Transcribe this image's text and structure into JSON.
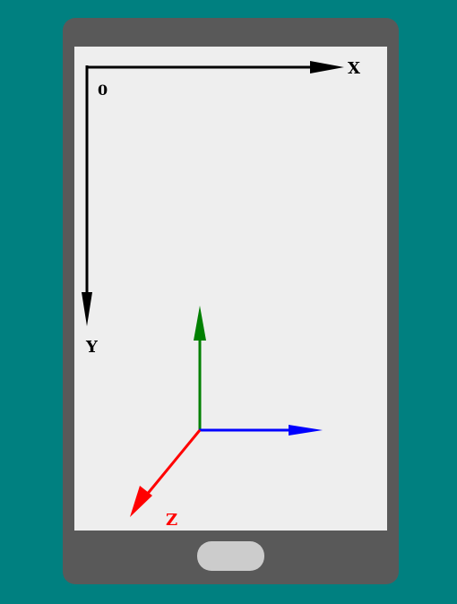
{
  "screen_axes": {
    "origin_label": "0",
    "x_label": "X",
    "y_label": "Y"
  },
  "device_axes": {
    "z_label": "Z"
  },
  "colors": {
    "background": "#008080",
    "phone_body": "#595959",
    "screen": "#eeeeee",
    "home_button": "#cccccc",
    "screen_axes": "#000000",
    "axis_vertical": "#008000",
    "axis_horizontal": "#0000ff",
    "axis_z": "#ff0000"
  }
}
